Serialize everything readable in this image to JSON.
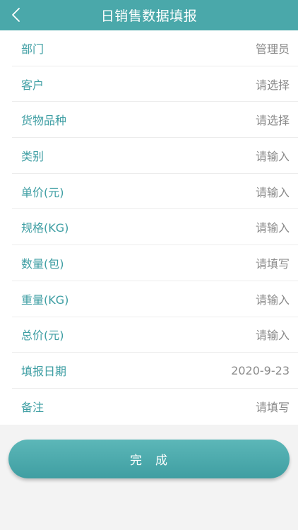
{
  "header": {
    "title": "日销售数据填报",
    "back_icon": "chevron-left-icon"
  },
  "colors": {
    "accent": "#4aa8aa",
    "label": "#3e9ea3",
    "value": "#8a8a8a",
    "background": "#f3f3f3"
  },
  "form": {
    "rows": [
      {
        "label": "部门",
        "value": "管理员"
      },
      {
        "label": "客户",
        "value": "请选择"
      },
      {
        "label": "货物品种",
        "value": "请选择"
      },
      {
        "label": "类别",
        "value": "请输入"
      },
      {
        "label": "单价(元)",
        "value": "请输入"
      },
      {
        "label": "规格(KG)",
        "value": "请输入"
      },
      {
        "label": "数量(包)",
        "value": "请填写"
      },
      {
        "label": "重量(KG)",
        "value": "请输入"
      },
      {
        "label": "总价(元)",
        "value": "请输入"
      },
      {
        "label": "填报日期",
        "value": "2020-9-23"
      },
      {
        "label": "备注",
        "value": "请填写"
      }
    ]
  },
  "submit": {
    "label": "完　成"
  }
}
